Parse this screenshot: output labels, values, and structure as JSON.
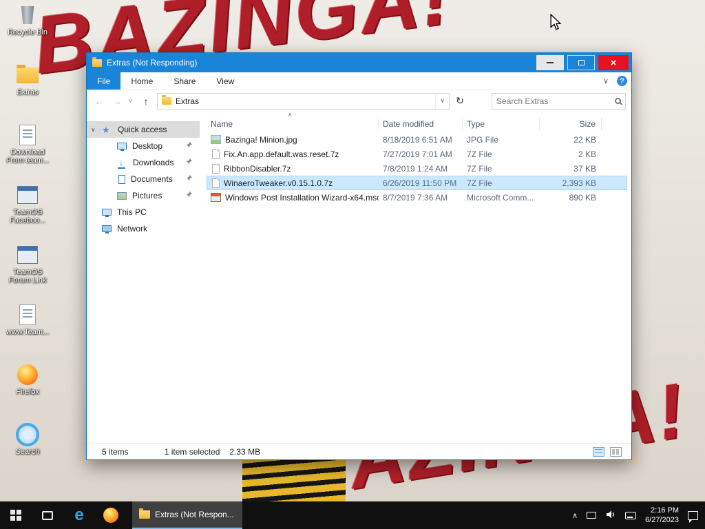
{
  "wallpaper": {
    "text": "BAZINGA!"
  },
  "desktop": {
    "icons": [
      {
        "label": "Recycle Bin",
        "icon": "recycle"
      },
      {
        "label": "Extras",
        "icon": "folder"
      },
      {
        "label": "Download From team...",
        "icon": "doc"
      },
      {
        "label": "TeamOS Faceboo...",
        "icon": "app"
      },
      {
        "label": "TeamOS Forum Link",
        "icon": "app"
      },
      {
        "label": "www.Team...",
        "icon": "doc"
      },
      {
        "label": "Firefox",
        "icon": "firefox"
      },
      {
        "label": "Search",
        "icon": "search"
      }
    ]
  },
  "window": {
    "title": "Extras (Not Responding)",
    "tabs": [
      {
        "label": "File",
        "active": true
      },
      {
        "label": "Home"
      },
      {
        "label": "Share"
      },
      {
        "label": "View"
      }
    ],
    "address": {
      "location": "Extras"
    },
    "search": {
      "placeholder": "Search Extras"
    },
    "columns": {
      "name": "Name",
      "date": "Date modified",
      "type": "Type",
      "size": "Size"
    },
    "files": [
      {
        "name": "Bazinga! Minion.jpg",
        "date": "8/18/2019 6:51 AM",
        "type": "JPG File",
        "size": "22 KB",
        "icon": "image"
      },
      {
        "name": "Fix.An.app.default.was.reset.7z",
        "date": "7/27/2019 7:01 AM",
        "type": "7Z File",
        "size": "2 KB",
        "icon": "archive"
      },
      {
        "name": "RibbonDisabler.7z",
        "date": "7/8/2019 1:24 AM",
        "type": "7Z File",
        "size": "37 KB",
        "icon": "archive"
      },
      {
        "name": "WinaeroTweaker.v0.15.1.0.7z",
        "date": "6/26/2019 11:50 PM",
        "type": "7Z File",
        "size": "2,393 KB",
        "icon": "archive",
        "selected": true
      },
      {
        "name": "Windows Post Installation Wizard-x64.msc",
        "date": "8/7/2019 7:36 AM",
        "type": "Microsoft Comm...",
        "size": "890 KB",
        "icon": "msc"
      }
    ],
    "sidebar": [
      {
        "label": "Quick access",
        "icon": "star",
        "active": true,
        "expander": true
      },
      {
        "label": "Desktop",
        "icon": "desktop",
        "pinned": true,
        "indent": true
      },
      {
        "label": "Downloads",
        "icon": "download",
        "pinned": true,
        "indent": true
      },
      {
        "label": "Documents",
        "icon": "docs",
        "pinned": true,
        "indent": true
      },
      {
        "label": "Pictures",
        "icon": "pictures",
        "pinned": true,
        "indent": true
      },
      {
        "label": "This PC",
        "icon": "pc"
      },
      {
        "label": "Network",
        "icon": "network"
      }
    ],
    "status": {
      "items": "5 items",
      "selected": "1 item selected",
      "size": "2.33 MB"
    }
  },
  "taskbar": {
    "task": {
      "label": "Extras (Not Respon..."
    },
    "clock": {
      "time": "2:16 PM",
      "date": "6/27/2023"
    }
  },
  "colors": {
    "accent": "#1984d8",
    "close": "#e81123",
    "selection": "#cce8ff"
  }
}
